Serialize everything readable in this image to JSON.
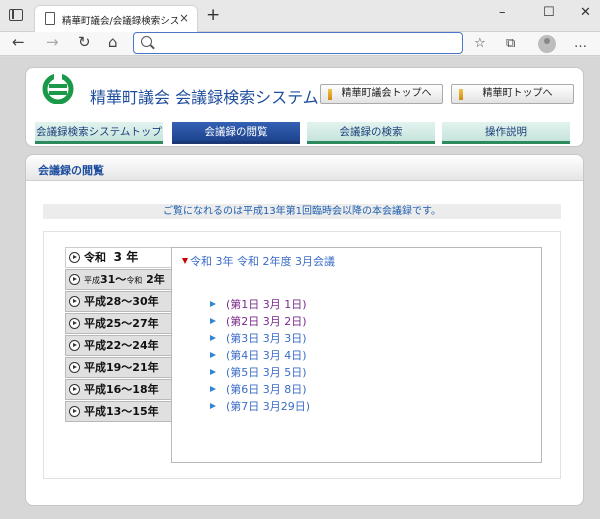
{
  "browser": {
    "tab_title": "精華町議会/会議録検索システム",
    "tab_close": "×",
    "new_tab": "+",
    "minimize": "–",
    "maximize": "☐",
    "close": "✕",
    "back": "←",
    "forward": "→",
    "reload": "↻",
    "home": "⌂",
    "address_value": "",
    "favorites": "☆",
    "collections": "⧉",
    "menu": "…"
  },
  "header": {
    "site_title": "精華町議会 会議録検索システム",
    "logo_color": "#1a9a48",
    "ext_buttons": [
      "精華町議会トップへ",
      "精華町トップへ"
    ]
  },
  "nav": {
    "tabs": [
      {
        "label": "会議録検索システムトップ",
        "active": false
      },
      {
        "label": "会議録の閲覧",
        "active": true
      },
      {
        "label": "会議録の検索",
        "active": false
      },
      {
        "label": "操作説明",
        "active": false
      }
    ]
  },
  "section": {
    "title": "会議録の閲覧",
    "notice": "ご覧になれるのは平成13年第1回臨時会以降の本会議録です。"
  },
  "eras": [
    {
      "prefix": "令和",
      "small": "",
      "range": "3 年",
      "current": true
    },
    {
      "prefix": "平成",
      "small": "平成",
      "range": "31～",
      "small2": "令和",
      "range2": "2年",
      "current": false
    },
    {
      "prefix": "平成",
      "small": "",
      "range": "28～30年",
      "current": false
    },
    {
      "prefix": "平成",
      "small": "",
      "range": "25～27年",
      "current": false
    },
    {
      "prefix": "平成",
      "small": "",
      "range": "22～24年",
      "current": false
    },
    {
      "prefix": "平成",
      "small": "",
      "range": "19～21年",
      "current": false
    },
    {
      "prefix": "平成",
      "small": "",
      "range": "16～18年",
      "current": false
    },
    {
      "prefix": "平成",
      "small": "",
      "range": "13～15年",
      "current": false
    }
  ],
  "session": {
    "heading": "令和 3年 令和 2年度 3月会議",
    "days": [
      {
        "label": "(第1日 3月 1日)",
        "visited": true
      },
      {
        "label": "(第2日 3月 2日)",
        "visited": true
      },
      {
        "label": "(第3日 3月 3日)",
        "visited": false
      },
      {
        "label": "(第4日 3月 4日)",
        "visited": false
      },
      {
        "label": "(第5日 3月 5日)",
        "visited": false
      },
      {
        "label": "(第6日 3月 8日)",
        "visited": false
      },
      {
        "label": "(第7日 3月29日)",
        "visited": false
      }
    ]
  }
}
